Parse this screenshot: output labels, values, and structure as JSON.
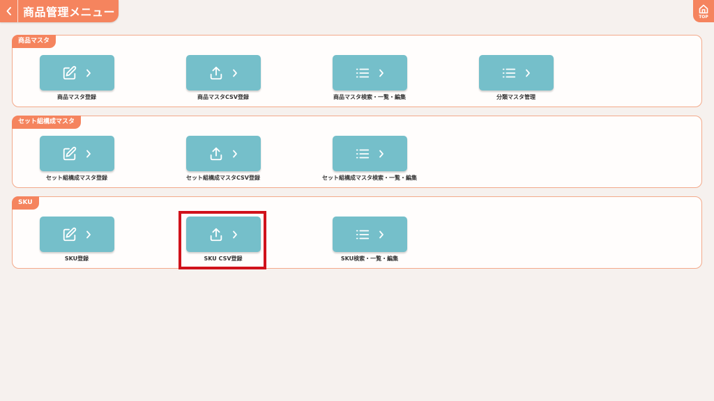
{
  "header": {
    "title": "商品管理メニュー",
    "top_label": "TOP",
    "back_icon": "chevron-left-icon",
    "top_icon": "home-icon"
  },
  "colors": {
    "accent": "#f5845e",
    "button": "#75bfca",
    "background": "#f6f1ee",
    "highlight": "#d0121b"
  },
  "sections": [
    {
      "label": "商品マスタ",
      "items": [
        {
          "label": "商品マスタ登録",
          "icon": "edit-icon"
        },
        {
          "label": "商品マスタCSV登録",
          "icon": "upload-icon"
        },
        {
          "label": "商品マスタ検索・一覧・編集",
          "icon": "list-icon"
        },
        {
          "label": "分類マスタ管理",
          "icon": "list-icon"
        }
      ]
    },
    {
      "label": "セット組構成マスタ",
      "items": [
        {
          "label": "セット組構成マスタ登録",
          "icon": "edit-icon"
        },
        {
          "label": "セット組構成マスタCSV登録",
          "icon": "upload-icon"
        },
        {
          "label": "セット組構成マスタ検索・一覧・編集",
          "icon": "list-icon"
        }
      ]
    },
    {
      "label": "SKU",
      "items": [
        {
          "label": "SKU登録",
          "icon": "edit-icon"
        },
        {
          "label": "SKU CSV登録",
          "icon": "upload-icon"
        },
        {
          "label": "SKU検索・一覧・編集",
          "icon": "list-icon"
        }
      ]
    }
  ]
}
